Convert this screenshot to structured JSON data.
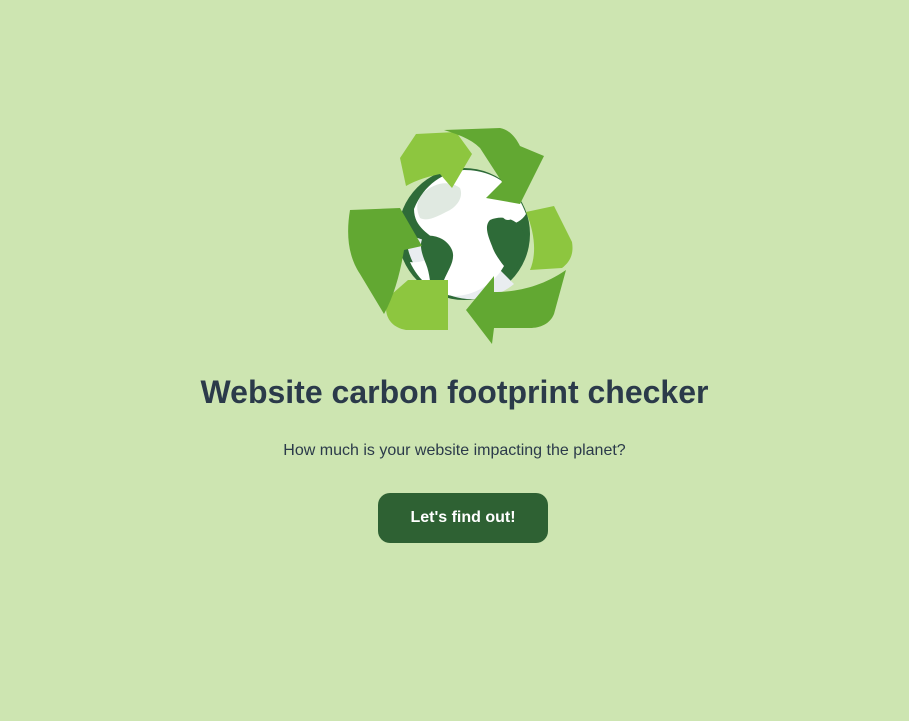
{
  "hero": {
    "logo_icon": "recycling-globe-icon",
    "title": "Website carbon footprint checker",
    "subtitle": "How much is your website impacting the planet?",
    "cta_label": "Let's find out!"
  },
  "colors": {
    "background": "#cde5b1",
    "text": "#2b3a4a",
    "button": "#2e6133",
    "button_text": "#ffffff",
    "arrow_light": "#8dc63f",
    "arrow_dark": "#62a832",
    "land": "#2e6b38"
  }
}
